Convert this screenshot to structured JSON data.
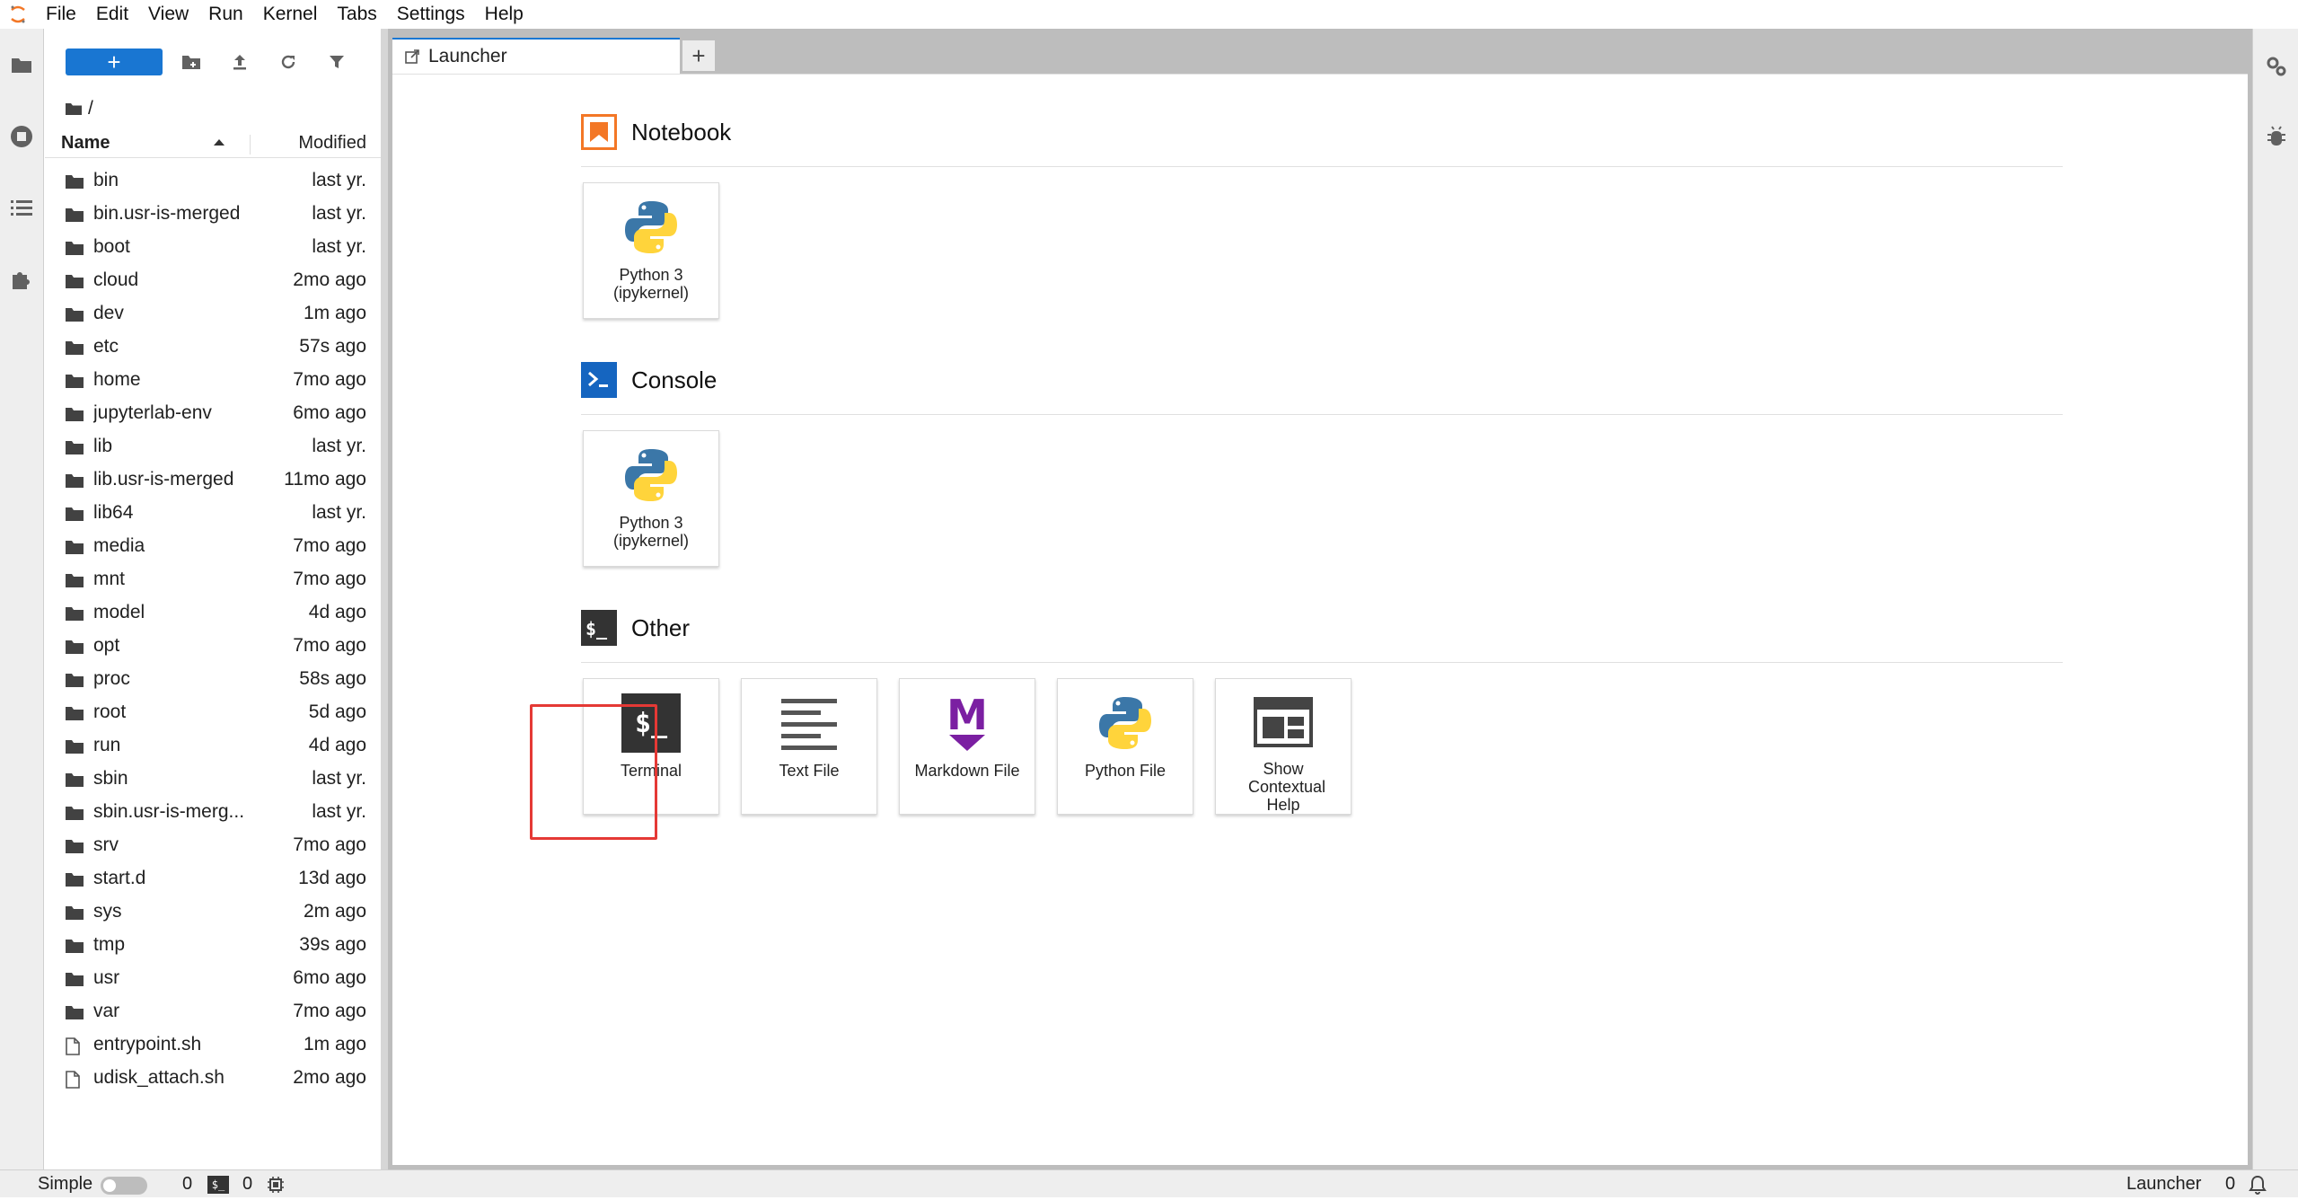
{
  "menubar": {
    "items": [
      "File",
      "Edit",
      "View",
      "Run",
      "Kernel",
      "Tabs",
      "Settings",
      "Help"
    ]
  },
  "activity_icons": [
    "folder-icon",
    "running-icon",
    "toc-icon",
    "extension-icon"
  ],
  "filebrowser": {
    "new_button_label": "+",
    "breadcrumb": "/",
    "header": {
      "name": "Name",
      "modified": "Modified"
    },
    "files": [
      {
        "name": "bin",
        "modified": "last yr.",
        "type": "folder"
      },
      {
        "name": "bin.usr-is-merged",
        "modified": "last yr.",
        "type": "folder"
      },
      {
        "name": "boot",
        "modified": "last yr.",
        "type": "folder"
      },
      {
        "name": "cloud",
        "modified": "2mo ago",
        "type": "folder"
      },
      {
        "name": "dev",
        "modified": "1m ago",
        "type": "folder"
      },
      {
        "name": "etc",
        "modified": "57s ago",
        "type": "folder"
      },
      {
        "name": "home",
        "modified": "7mo ago",
        "type": "folder"
      },
      {
        "name": "jupyterlab-env",
        "modified": "6mo ago",
        "type": "folder"
      },
      {
        "name": "lib",
        "modified": "last yr.",
        "type": "folder"
      },
      {
        "name": "lib.usr-is-merged",
        "modified": "11mo ago",
        "type": "folder"
      },
      {
        "name": "lib64",
        "modified": "last yr.",
        "type": "folder"
      },
      {
        "name": "media",
        "modified": "7mo ago",
        "type": "folder"
      },
      {
        "name": "mnt",
        "modified": "7mo ago",
        "type": "folder"
      },
      {
        "name": "model",
        "modified": "4d ago",
        "type": "folder"
      },
      {
        "name": "opt",
        "modified": "7mo ago",
        "type": "folder"
      },
      {
        "name": "proc",
        "modified": "58s ago",
        "type": "folder"
      },
      {
        "name": "root",
        "modified": "5d ago",
        "type": "folder"
      },
      {
        "name": "run",
        "modified": "4d ago",
        "type": "folder"
      },
      {
        "name": "sbin",
        "modified": "last yr.",
        "type": "folder"
      },
      {
        "name": "sbin.usr-is-merg...",
        "modified": "last yr.",
        "type": "folder"
      },
      {
        "name": "srv",
        "modified": "7mo ago",
        "type": "folder"
      },
      {
        "name": "start.d",
        "modified": "13d ago",
        "type": "folder"
      },
      {
        "name": "sys",
        "modified": "2m ago",
        "type": "folder"
      },
      {
        "name": "tmp",
        "modified": "39s ago",
        "type": "folder"
      },
      {
        "name": "usr",
        "modified": "6mo ago",
        "type": "folder"
      },
      {
        "name": "var",
        "modified": "7mo ago",
        "type": "folder"
      },
      {
        "name": "entrypoint.sh",
        "modified": "1m ago",
        "type": "file"
      },
      {
        "name": "udisk_attach.sh",
        "modified": "2mo ago",
        "type": "file"
      }
    ]
  },
  "tabs": [
    {
      "label": "Launcher"
    }
  ],
  "tab_add_label": "+",
  "launcher": {
    "sections": [
      {
        "title": "Notebook",
        "cards": [
          {
            "label": "Python 3 (ipykernel)",
            "icon": "python-icon"
          }
        ]
      },
      {
        "title": "Console",
        "cards": [
          {
            "label": "Python 3 (ipykernel)",
            "icon": "python-icon"
          }
        ]
      },
      {
        "title": "Other",
        "cards": [
          {
            "label": "Terminal",
            "icon": "terminal-icon"
          },
          {
            "label": "Text File",
            "icon": "text-file-icon"
          },
          {
            "label": "Markdown File",
            "icon": "markdown-icon"
          },
          {
            "label": "Python File",
            "icon": "python-icon"
          },
          {
            "label": "Show Contextual Help",
            "icon": "contextual-help-icon"
          }
        ]
      }
    ],
    "terminal_icon_text": "$_",
    "markdown_letter": "M",
    "highlight_color": "#e53935"
  },
  "statusbar": {
    "mode_label": "Simple",
    "kernels_count": "0",
    "terminals_count": "0",
    "terminal_badge": "$_",
    "right_label": "Launcher",
    "right_count": "0"
  },
  "colors": {
    "accent": "#1976d2",
    "notebook_orange": "#f37726",
    "console_blue": "#0d47a1",
    "markdown_purple": "#7b1fa2"
  }
}
